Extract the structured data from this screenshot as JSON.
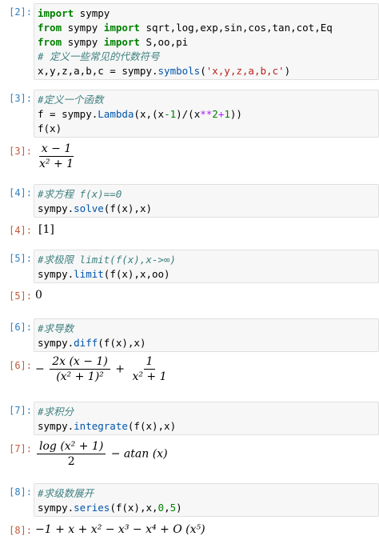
{
  "cells": [
    {
      "in_prompt": "[2]:",
      "lines": [
        [
          "import",
          " sympy"
        ],
        [
          "from",
          " sympy ",
          "import",
          " sqrt,log,exp,sin,cos,tan,cot,Eq"
        ],
        [
          "from",
          " sympy ",
          "import",
          " S,oo,pi"
        ],
        [
          "# 定义一些常见的代数符号"
        ],
        [
          "x,y,z,a,b,c = sympy.",
          "symbols",
          "(",
          "'x,y,z,a,b,c'",
          ")"
        ]
      ]
    },
    {
      "in_prompt": "[3]:",
      "comment": "#定义一个函数",
      "code_line1_a": "f = sympy.",
      "code_line1_b": "Lambda",
      "code_line1_c": "(x,(x",
      "code_line1_d": "-1",
      "code_line1_e": ")/(x",
      "code_line1_f": "**",
      "code_line1_g": "2",
      "code_line1_h": "+",
      "code_line1_i": "1",
      "code_line1_j": "))",
      "code_line2": "f(x)",
      "out_prompt": "[3]:",
      "out_num": "x − 1",
      "out_den": "x² + 1"
    },
    {
      "in_prompt": "[4]:",
      "comment": "#求方程 f(x)==0",
      "code_a": "sympy.",
      "code_b": "solve",
      "code_c": "(f(x),x)",
      "out_prompt": "[4]:",
      "output": "[1]"
    },
    {
      "in_prompt": "[5]:",
      "comment": "#求极限 limit(f(x),x->∞)",
      "code_a": "sympy.",
      "code_b": "limit",
      "code_c": "(f(x),x,oo)",
      "out_prompt": "[5]:",
      "output": "0"
    },
    {
      "in_prompt": "[6]:",
      "comment": "#求导数",
      "code_a": "sympy.",
      "code_b": "diff",
      "code_c": "(f(x),x)",
      "out_prompt": "[6]:",
      "out_frac1_num": "2x (x − 1)",
      "out_frac1_den": "(x² + 1)²",
      "out_frac2_num": "1",
      "out_frac2_den": "x² + 1"
    },
    {
      "in_prompt": "[7]:",
      "comment": "#求积分",
      "code_a": "sympy.",
      "code_b": "integrate",
      "code_c": "(f(x),x)",
      "out_prompt": "[7]:",
      "out_num": "log (x² + 1)",
      "out_den": "2",
      "out_tail": "− atan (x)"
    },
    {
      "in_prompt": "[8]:",
      "comment": "#求级数展开",
      "code_a": "sympy.",
      "code_b": "series",
      "code_c": "(f(x),x,",
      "code_d": "0",
      "code_e": ",",
      "code_f": "5",
      "code_g": ")",
      "out_prompt": "[8]:",
      "output": "−1 + x + x² − x³ − x⁴ + O (x⁵)"
    }
  ]
}
